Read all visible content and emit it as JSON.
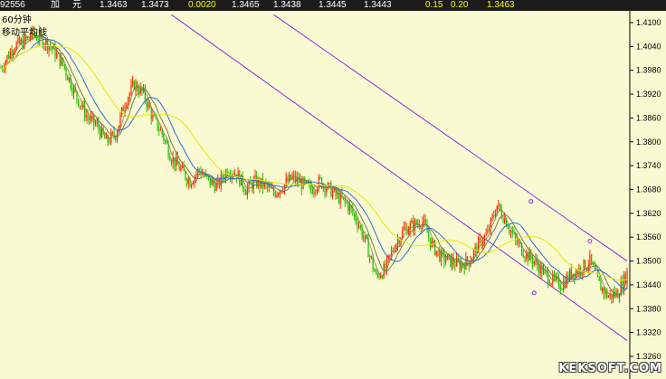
{
  "topbar": {
    "code": "92556",
    "label1": "加",
    "label2": "元",
    "v1": "1.3463",
    "v2": "1.3473",
    "change": "0.0020",
    "v3": "1.3465",
    "v4": "1.3438",
    "v5": "1.3445",
    "v6": "1.3443",
    "v7": "0.15",
    "v8": "0.20",
    "v9": "1.3463",
    "colors": {
      "white": "#ffffff",
      "yellow": "#ffff00"
    }
  },
  "panel": {
    "period": "60分钟",
    "indicator": "移动平均线"
  },
  "watermark": "KEKSOFT.COM",
  "colors": {
    "background": "#fafad2",
    "up_candle": "#ff2a00",
    "down_candle": "#22c000",
    "ma_short": "#7a7a50",
    "ma_mid": "#2a6cdb",
    "ma_long": "#e8e800",
    "channel": "#8a2be2",
    "axis": "#000000"
  },
  "chart_data": {
    "type": "candlestick",
    "yticks": [
      "1.4100",
      "1.4040",
      "1.3980",
      "1.3920",
      "1.3860",
      "1.3800",
      "1.3740",
      "1.3680",
      "1.3620",
      "1.3560",
      "1.3500",
      "1.3440",
      "1.3380",
      "1.3320",
      "1.3260"
    ],
    "ylim": [
      1.326,
      1.412
    ],
    "anchors": [
      [
        0,
        1.3985
      ],
      [
        8,
        1.404
      ],
      [
        14,
        1.405
      ],
      [
        20,
        1.407
      ],
      [
        26,
        1.406
      ],
      [
        32,
        1.404
      ],
      [
        40,
        1.3995
      ],
      [
        48,
        1.392
      ],
      [
        56,
        1.386
      ],
      [
        62,
        1.384
      ],
      [
        68,
        1.38
      ],
      [
        74,
        1.382
      ],
      [
        80,
        1.39
      ],
      [
        86,
        1.3945
      ],
      [
        92,
        1.392
      ],
      [
        98,
        1.386
      ],
      [
        104,
        1.382
      ],
      [
        110,
        1.376
      ],
      [
        116,
        1.373
      ],
      [
        122,
        1.37
      ],
      [
        128,
        1.373
      ],
      [
        134,
        1.37
      ],
      [
        140,
        1.369
      ],
      [
        146,
        1.373
      ],
      [
        152,
        1.372
      ],
      [
        158,
        1.368
      ],
      [
        164,
        1.37
      ],
      [
        170,
        1.369
      ],
      [
        176,
        1.367
      ],
      [
        182,
        1.369
      ],
      [
        188,
        1.371
      ],
      [
        194,
        1.3695
      ],
      [
        200,
        1.368
      ],
      [
        206,
        1.37
      ],
      [
        212,
        1.368
      ],
      [
        218,
        1.366
      ],
      [
        224,
        1.364
      ],
      [
        230,
        1.36
      ],
      [
        236,
        1.354
      ],
      [
        242,
        1.346
      ],
      [
        248,
        1.348
      ],
      [
        254,
        1.354
      ],
      [
        260,
        1.358
      ],
      [
        266,
        1.359
      ],
      [
        272,
        1.36
      ],
      [
        278,
        1.354
      ],
      [
        284,
        1.351
      ],
      [
        290,
        1.35
      ],
      [
        296,
        1.349
      ],
      [
        302,
        1.35
      ],
      [
        308,
        1.354
      ],
      [
        314,
        1.357
      ],
      [
        320,
        1.364
      ],
      [
        326,
        1.36
      ],
      [
        332,
        1.355
      ],
      [
        338,
        1.352
      ],
      [
        344,
        1.35
      ],
      [
        350,
        1.347
      ],
      [
        356,
        1.345
      ],
      [
        362,
        1.344
      ],
      [
        368,
        1.347
      ],
      [
        374,
        1.348
      ],
      [
        380,
        1.35
      ],
      [
        386,
        1.344
      ],
      [
        392,
        1.341
      ],
      [
        398,
        1.342
      ],
      [
        404,
        1.347
      ]
    ],
    "bar_count": 405,
    "ma_periods": [
      5,
      10,
      20,
      40
    ],
    "channel": {
      "upper": {
        "from": [
          176,
          1.412
        ],
        "to": [
          404,
          1.35
        ]
      },
      "lower": {
        "from": [
          110,
          1.412
        ],
        "to": [
          404,
          1.33
        ]
      }
    },
    "markers": [
      [
        342,
        1.365
      ],
      [
        380,
        1.355
      ],
      [
        344,
        1.342
      ]
    ]
  }
}
